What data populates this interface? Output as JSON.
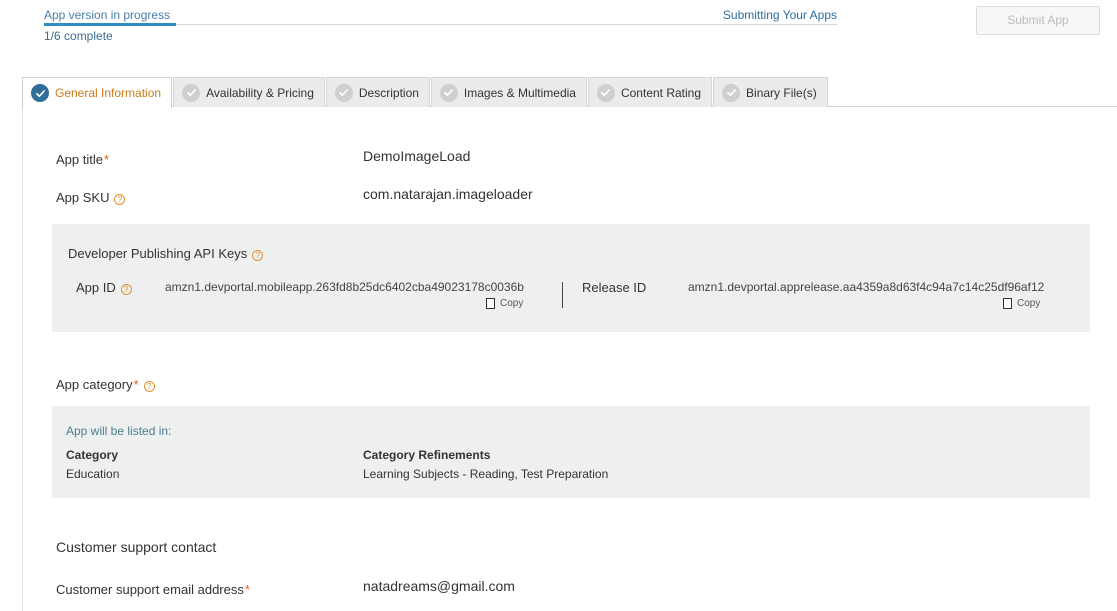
{
  "progress": {
    "label": "App version in progress",
    "link": "Submitting Your Apps",
    "count": "1/6 complete",
    "fraction": 0.1667
  },
  "submit_button": "Submit App",
  "tabs": [
    {
      "label": "General Information",
      "active": true
    },
    {
      "label": "Availability & Pricing",
      "active": false
    },
    {
      "label": "Description",
      "active": false
    },
    {
      "label": "Images & Multimedia",
      "active": false
    },
    {
      "label": "Content Rating",
      "active": false
    },
    {
      "label": "Binary File(s)",
      "active": false
    }
  ],
  "fields": {
    "app_title": {
      "label": "App title",
      "required": "*",
      "value": "DemoImageLoad"
    },
    "app_sku": {
      "label": "App SKU",
      "help": "?",
      "value": "com.natarajan.imageloader"
    }
  },
  "api_keys": {
    "title": "Developer Publishing API Keys",
    "help": "?",
    "app_id": {
      "label": "App ID",
      "help": "?",
      "value": "amzn1.devportal.mobileapp.263fd8b25dc6402cba49023178c0036b",
      "copy": "Copy"
    },
    "release_id": {
      "label": "Release ID",
      "value": "amzn1.devportal.apprelease.aa4359a8d63f4c94a7c14c25df96af12",
      "copy": "Copy"
    }
  },
  "category": {
    "label": "App category",
    "required": "*",
    "help": "?",
    "listed_in": "App will be listed in:",
    "category_header": "Category",
    "category_value": "Education",
    "refinements_header": "Category Refinements",
    "refinements_value": "Learning Subjects - Reading, Test Preparation"
  },
  "support": {
    "section_title": "Customer support contact",
    "email_label": "Customer support email address",
    "required": "*",
    "email_value": "natadreams@gmail.com"
  },
  "colors": {
    "accent_blue": "#2e8fc4",
    "active_tab_text": "#c77b1a",
    "required": "#d9651c",
    "panel_bg": "#eef0ef"
  },
  "icons": {
    "tab_check": "check-circle-icon",
    "help": "help-circle-icon",
    "copy": "copy-icon"
  }
}
